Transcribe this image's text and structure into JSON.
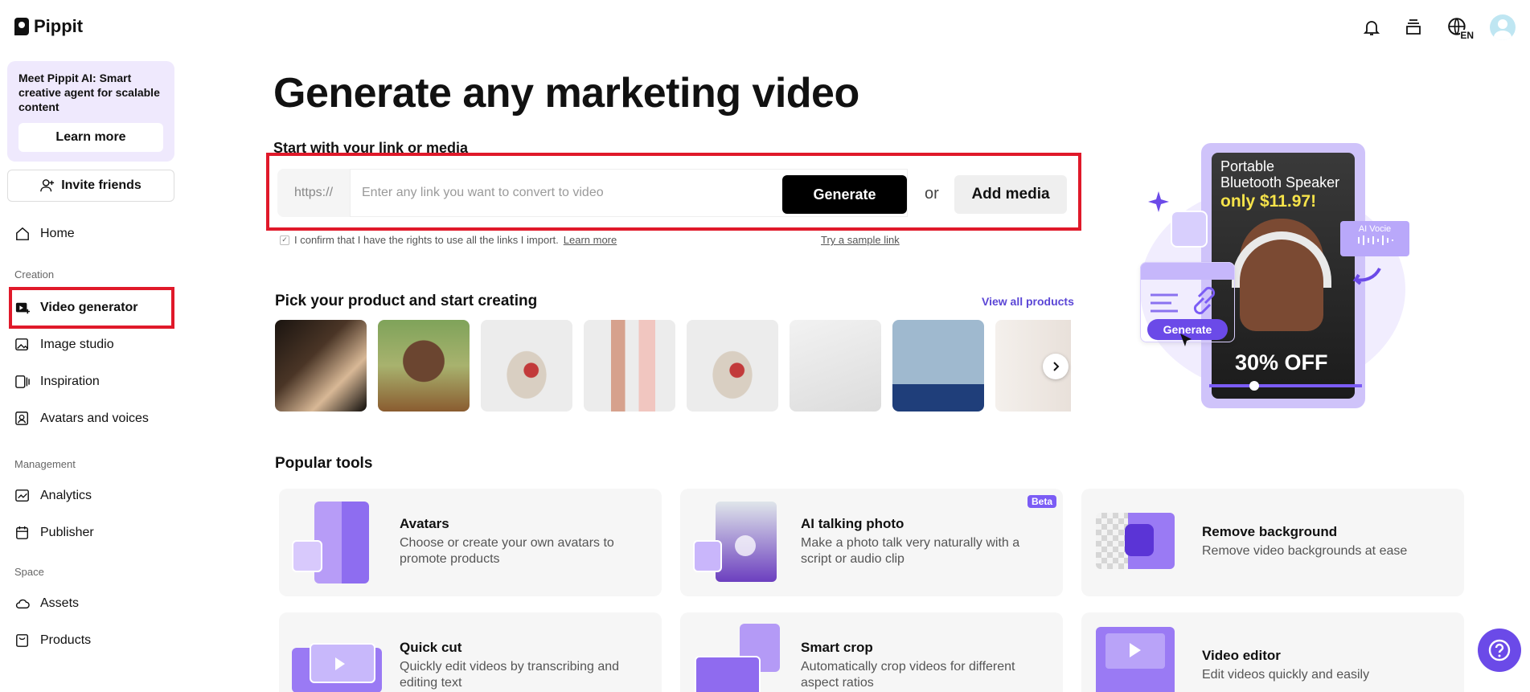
{
  "app": {
    "name": "Pippit"
  },
  "sidebar": {
    "promo": {
      "text": "Meet Pippit AI: Smart creative agent for scalable content",
      "button": "Learn more"
    },
    "invite": "Invite friends",
    "home": "Home",
    "sections": {
      "creation": "Creation",
      "management": "Management",
      "space": "Space"
    },
    "items": {
      "video_generator": "Video generator",
      "image_studio": "Image studio",
      "inspiration": "Inspiration",
      "avatars_voices": "Avatars and voices",
      "analytics": "Analytics",
      "publisher": "Publisher",
      "assets": "Assets",
      "products": "Products"
    }
  },
  "header": {
    "language": "EN"
  },
  "main": {
    "title": "Generate any marketing video",
    "subhead": "Start with your link or media",
    "url_prefix": "https://",
    "url_placeholder": "Enter any link you want to convert to video",
    "generate": "Generate",
    "or": "or",
    "add_media": "Add media",
    "confirm_text": "I confirm that I have the rights to use all the links I import.",
    "confirm_learn": "Learn more",
    "sample_link": "Try a sample link",
    "pick_title": "Pick your product and start creating",
    "view_all": "View all products"
  },
  "hero": {
    "line1": "Portable",
    "line2": "Bluetooth Speaker",
    "price": "only $11.97!",
    "off": "30% OFF",
    "voice": "AI Vocie",
    "generate": "Generate"
  },
  "tools": {
    "title": "Popular tools",
    "items": [
      {
        "name": "Avatars",
        "desc": "Choose or create your own avatars to promote products"
      },
      {
        "name": "AI talking photo",
        "desc": "Make a photo talk very naturally with a script or audio clip",
        "badge": "Beta"
      },
      {
        "name": "Remove background",
        "desc": "Remove video backgrounds at ease"
      },
      {
        "name": "Quick cut",
        "desc": "Quickly edit videos by transcribing and editing text"
      },
      {
        "name": "Smart crop",
        "desc": "Automatically crop videos for different aspect ratios"
      },
      {
        "name": "Video editor",
        "desc": "Edit videos quickly and easily"
      }
    ]
  },
  "colors": {
    "accent": "#6b4ae8",
    "highlight": "#e0192a",
    "promo_bg": "#efe9fd"
  }
}
